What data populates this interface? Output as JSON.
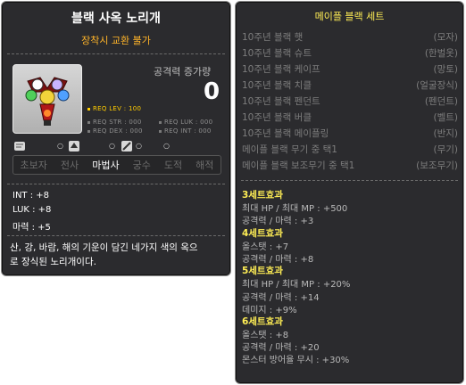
{
  "item": {
    "name": "블랙 사옥 노리개",
    "trade_note": "장착시 교환 불가",
    "attack_increase_label": "공격력 증가량",
    "attack_increase_value": "0",
    "req": {
      "lev": "REQ LEV : 100",
      "str": "REQ STR : 000",
      "luk": "REQ LUK : 000",
      "dex": "REQ DEX : 000",
      "int": "REQ INT : 000"
    },
    "flag_marks": [
      "○",
      "○",
      "○",
      "○"
    ],
    "classes": [
      {
        "label": "초보자",
        "enabled": false
      },
      {
        "label": "전사",
        "enabled": false
      },
      {
        "label": "마법사",
        "enabled": true
      },
      {
        "label": "궁수",
        "enabled": false
      },
      {
        "label": "도적",
        "enabled": false
      },
      {
        "label": "해적",
        "enabled": false
      }
    ],
    "stats": [
      "INT : +8",
      "LUK : +8",
      "마력 : +5"
    ],
    "description_lines": [
      "산, 강, 바람, 해의 기운이 담긴 네가지 색의 옥으",
      "로 장식된 노리개이다."
    ]
  },
  "set": {
    "title": "메이플 블랙 세트",
    "pieces": [
      {
        "name": "10주년 블랙 햇",
        "type": "(모자)"
      },
      {
        "name": "10주년 블랙 슈트",
        "type": "(한벌옷)"
      },
      {
        "name": "10주년 블랙 케이프",
        "type": "(망토)"
      },
      {
        "name": "10주년 블랙 치클",
        "type": "(얼굴장식)"
      },
      {
        "name": "10주년 블랙 펜던트",
        "type": "(펜던트)"
      },
      {
        "name": "10주년 블랙 버클",
        "type": "(벨트)"
      },
      {
        "name": "10주년 블랙 메이플링",
        "type": "(반지)"
      },
      {
        "name": "메이플 블랙 무기 중 택1",
        "type": "(무기)"
      },
      {
        "name": "메이플 블랙 보조무기 중 택1",
        "type": "(보조무기)"
      }
    ],
    "effects": [
      {
        "heading": "3세트효과",
        "lines": [
          "최대 HP / 최대 MP : +500",
          "공격력 / 마력 : +3"
        ]
      },
      {
        "heading": "4세트효과",
        "lines": [
          "올스탯 : +7",
          "공격력 / 마력 : +8"
        ]
      },
      {
        "heading": "5세트효과",
        "lines": [
          "최대 HP / 최대 MP : +20%",
          "공격력 / 마력 : +14",
          "데미지 : +9%"
        ]
      },
      {
        "heading": "6세트효과",
        "lines": [
          "올스탯 : +8",
          "공격력 / 마력 : +20",
          "몬스터 방어율 무시 : +30%"
        ]
      }
    ]
  },
  "colors": {
    "panel_bg": "#2b2b2e",
    "accent_yellow": "#ffee55",
    "trade_orange": "#ffb429",
    "disabled_gray": "#7d7d7d"
  }
}
